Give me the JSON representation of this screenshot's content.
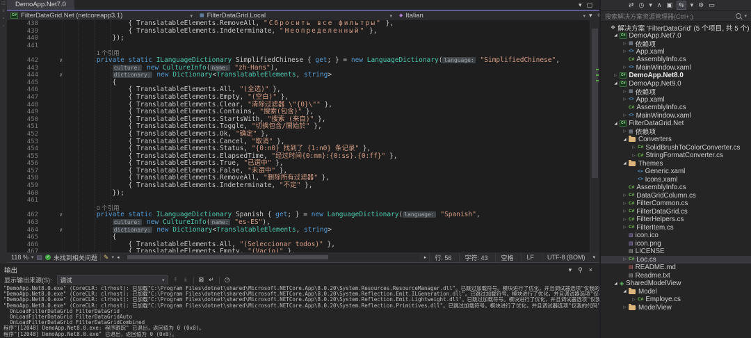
{
  "accents": {
    "active_window_line": "#615c97",
    "keyword_blue": "#569cd6",
    "type_teal": "#4ec9b0",
    "string_salmon": "#d69d85",
    "check_green": "#3fa33f",
    "folder_yellow": "#dcb67a",
    "selection_gray": "#37373d"
  },
  "left_strip_icons": [
    {
      "name": "side-toolbar-icon",
      "glyph": "◫"
    },
    {
      "name": "side-toolbar-icon",
      "glyph": "≡"
    },
    {
      "name": "side-toolbar-icon",
      "glyph": "▪"
    },
    {
      "name": "side-toolbar-icon",
      "glyph": "▫"
    }
  ],
  "editor": {
    "tab_label": "DemoApp.Net7.0",
    "tab_right_icons": [
      {
        "name": "active-files-dropdown-icon",
        "glyph": "▾"
      },
      {
        "name": "float-window-icon",
        "glyph": "▢"
      }
    ],
    "status": {
      "zoom": "118 %",
      "issues": "未找到相关问题",
      "line": "行: 56",
      "column": "字符: 43",
      "spaces": "空格",
      "line_ending": "LF",
      "encoding": "UTF-8 (BOM)"
    },
    "rows": [
      {
        "n": "438",
        "tk": [
          [
            "p",
            "                { TranslatableElements.RemoveAll, "
          ],
          [
            "sr",
            "\"Сбросить все фильтры\""
          ],
          [
            "p",
            " },"
          ]
        ]
      },
      {
        "n": "439",
        "tk": [
          [
            "p",
            "                { TranslatableElements.Indeterminate, "
          ],
          [
            "sr",
            "\"Неопределенный\""
          ],
          [
            "p",
            " },"
          ]
        ]
      },
      {
        "n": "440",
        "tk": [
          [
            "p",
            "            });"
          ]
        ]
      },
      {
        "n": "441",
        "tk": []
      },
      {
        "n": "",
        "lens": true,
        "tk": [
          [
            "l",
            "1 个引用"
          ]
        ]
      },
      {
        "n": "442",
        "c": 1,
        "tk": [
          [
            "p",
            "        "
          ],
          [
            "k",
            "private static "
          ],
          [
            "t",
            "ILanguageDictionary"
          ],
          [
            "p",
            " SimplifiedChinese { "
          ],
          [
            "k",
            "get"
          ],
          [
            "p",
            "; } = "
          ],
          [
            "k",
            "new"
          ],
          [
            "p",
            " "
          ],
          [
            "t",
            "LanguageDictionary"
          ],
          [
            "p",
            "("
          ],
          [
            "h",
            "language:"
          ],
          [
            "p",
            " "
          ],
          [
            "s",
            "\"SimplifiedChinese\""
          ],
          [
            "p",
            ","
          ]
        ]
      },
      {
        "n": "443",
        "tk": [
          [
            "p",
            "            "
          ],
          [
            "h",
            "culture:"
          ],
          [
            "p",
            " "
          ],
          [
            "k",
            "new"
          ],
          [
            "p",
            " "
          ],
          [
            "t",
            "CultureInfo"
          ],
          [
            "p",
            "("
          ],
          [
            "h",
            "name:"
          ],
          [
            "p",
            " "
          ],
          [
            "s",
            "\"zh-Hans\""
          ],
          [
            "p",
            "),"
          ]
        ]
      },
      {
        "n": "444",
        "c": 1,
        "tk": [
          [
            "p",
            "            "
          ],
          [
            "h",
            "dictionary:"
          ],
          [
            "p",
            " "
          ],
          [
            "k",
            "new"
          ],
          [
            "p",
            " "
          ],
          [
            "t",
            "Dictionary"
          ],
          [
            "p",
            "<"
          ],
          [
            "t",
            "TranslatableElements"
          ],
          [
            "p",
            ", "
          ],
          [
            "k",
            "string"
          ],
          [
            "p",
            ">"
          ]
        ]
      },
      {
        "n": "445",
        "tk": [
          [
            "p",
            "            {"
          ]
        ]
      },
      {
        "n": "446",
        "tk": [
          [
            "p",
            "                { TranslatableElements.All, "
          ],
          [
            "s",
            "\"(全选)\""
          ],
          [
            "p",
            " },"
          ]
        ]
      },
      {
        "n": "447",
        "tk": [
          [
            "p",
            "                { TranslatableElements.Empty, "
          ],
          [
            "s",
            "\"(空白)\""
          ],
          [
            "p",
            " },"
          ]
        ]
      },
      {
        "n": "448",
        "tk": [
          [
            "p",
            "                { TranslatableElements.Clear, "
          ],
          [
            "s",
            "\"清除过滤器 \\\"{0}\\\"\""
          ],
          [
            "p",
            " },"
          ]
        ]
      },
      {
        "n": "449",
        "tk": [
          [
            "p",
            "                { TranslatableElements.Contains, "
          ],
          [
            "s",
            "\"搜索(包含)\""
          ],
          [
            "p",
            " },"
          ]
        ]
      },
      {
        "n": "450",
        "tk": [
          [
            "p",
            "                { TranslatableElements.StartsWith, "
          ],
          [
            "s",
            "\"搜索 (来自)\""
          ],
          [
            "p",
            " },"
          ]
        ]
      },
      {
        "n": "451",
        "tk": [
          [
            "p",
            "                { TranslatableElements.Toggle, "
          ],
          [
            "s",
            "\"切换包含/開始於\""
          ],
          [
            "p",
            " },"
          ]
        ]
      },
      {
        "n": "452",
        "tk": [
          [
            "p",
            "                { TranslatableElements.Ok, "
          ],
          [
            "s",
            "\"确定\""
          ],
          [
            "p",
            " },"
          ]
        ]
      },
      {
        "n": "453",
        "tk": [
          [
            "p",
            "                { TranslatableElements.Cancel, "
          ],
          [
            "s",
            "\"取消\""
          ],
          [
            "p",
            " },"
          ]
        ]
      },
      {
        "n": "454",
        "tk": [
          [
            "p",
            "                { TranslatableElements.Status, "
          ],
          [
            "s",
            "\"{0:n0} 找到了 {1:n0} 条记录\""
          ],
          [
            "p",
            " },"
          ]
        ]
      },
      {
        "n": "455",
        "tk": [
          [
            "p",
            "                { TranslatableElements.ElapsedTime, "
          ],
          [
            "s",
            "\"经过时间{0:mm}:{0:ss}.{0:ff}\""
          ],
          [
            "p",
            " },"
          ]
        ]
      },
      {
        "n": "456",
        "tk": [
          [
            "p",
            "                { TranslatableElements.True, "
          ],
          [
            "s",
            "\"已選中\""
          ],
          [
            "p",
            " },"
          ]
        ]
      },
      {
        "n": "457",
        "tk": [
          [
            "p",
            "                { TranslatableElements.False, "
          ],
          [
            "s",
            "\"未選中\""
          ],
          [
            "p",
            " },"
          ]
        ]
      },
      {
        "n": "458",
        "tk": [
          [
            "p",
            "                { TranslatableElements.RemoveAll, "
          ],
          [
            "s",
            "\"删除所有过滤器\""
          ],
          [
            "p",
            " },"
          ]
        ]
      },
      {
        "n": "459",
        "tk": [
          [
            "p",
            "                { TranslatableElements.Indeterminate, "
          ],
          [
            "s",
            "\"不定\""
          ],
          [
            "p",
            " },"
          ]
        ]
      },
      {
        "n": "460",
        "tk": [
          [
            "p",
            "            });"
          ]
        ]
      },
      {
        "n": "461",
        "tk": []
      },
      {
        "n": "",
        "lens": true,
        "tk": [
          [
            "l",
            "0 个引用"
          ]
        ]
      },
      {
        "n": "462",
        "c": 1,
        "tk": [
          [
            "p",
            "        "
          ],
          [
            "k",
            "private static "
          ],
          [
            "t",
            "ILanguageDictionary"
          ],
          [
            "p",
            " Spanish { "
          ],
          [
            "k",
            "get"
          ],
          [
            "p",
            "; } = "
          ],
          [
            "k",
            "new"
          ],
          [
            "p",
            " "
          ],
          [
            "t",
            "LanguageDictionary"
          ],
          [
            "p",
            "("
          ],
          [
            "h",
            "language:"
          ],
          [
            "p",
            " "
          ],
          [
            "s",
            "\"Spanish\""
          ],
          [
            "p",
            ","
          ]
        ]
      },
      {
        "n": "463",
        "tk": [
          [
            "p",
            "            "
          ],
          [
            "h",
            "culture:"
          ],
          [
            "p",
            " "
          ],
          [
            "k",
            "new"
          ],
          [
            "p",
            " "
          ],
          [
            "t",
            "CultureInfo"
          ],
          [
            "p",
            "("
          ],
          [
            "h",
            "name:"
          ],
          [
            "p",
            " "
          ],
          [
            "s",
            "\"es-ES\""
          ],
          [
            "p",
            "),"
          ]
        ]
      },
      {
        "n": "464",
        "c": 1,
        "tk": [
          [
            "p",
            "            "
          ],
          [
            "h",
            "dictionary:"
          ],
          [
            "p",
            " "
          ],
          [
            "k",
            "new"
          ],
          [
            "p",
            " "
          ],
          [
            "t",
            "Dictionary"
          ],
          [
            "p",
            "<"
          ],
          [
            "t",
            "TranslatableElements"
          ],
          [
            "p",
            ", "
          ],
          [
            "k",
            "string"
          ],
          [
            "p",
            ">"
          ]
        ]
      },
      {
        "n": "465",
        "tk": [
          [
            "p",
            "            {"
          ]
        ]
      },
      {
        "n": "466",
        "tk": [
          [
            "p",
            "                { TranslatableElements.All, "
          ],
          [
            "s",
            "\"(Seleccionar todos)\""
          ],
          [
            "p",
            " },"
          ]
        ]
      },
      {
        "n": "467",
        "tk": [
          [
            "p",
            "                { TranslatableElements.Empty, "
          ],
          [
            "s",
            "\"(Vacío)\""
          ],
          [
            "p",
            " },"
          ]
        ]
      }
    ]
  },
  "navbar": {
    "project": "FilterDataGrid.Net (netcoreapp3.1)",
    "class_name": "FilterDataGrid.Local",
    "member": "Italian",
    "right_icons": [
      {
        "name": "navbar-dropdown-icon",
        "glyph": "▾"
      },
      {
        "name": "split-window-icon",
        "glyph": "+"
      }
    ]
  },
  "output": {
    "title": "输出",
    "source_label": "显示输出来源(S):",
    "source_value": "调试",
    "toolbar_icons": [
      {
        "name": "previous-message-icon",
        "glyph": "↟",
        "disabled": true
      },
      {
        "name": "next-message-icon",
        "glyph": "↡",
        "disabled": true
      },
      {
        "sep": true
      },
      {
        "name": "clear-all-icon",
        "glyph": "⊠"
      },
      {
        "name": "toggle-word-wrap-icon",
        "glyph": "↵"
      },
      {
        "sep": true
      },
      {
        "name": "time-icon",
        "glyph": "◷"
      }
    ],
    "panel_buttons": [
      {
        "name": "window-position-icon",
        "glyph": "▾"
      },
      {
        "name": "pin-icon",
        "glyph": "⚲"
      },
      {
        "name": "close-icon",
        "glyph": "×"
      }
    ],
    "lines": [
      "\"DemoApp.Net8.0.exe\" (CoreCLR: clrhost): 已加载\"C:\\Program Files\\dotnet\\shared\\Microsoft.NETCore.App\\8.0.20\\System.Resources.ResourceManager.dll\"。已跳过加载符号。模块进行了优化，并且调试器选项\"仅我的代码\"已启用。",
      "\"DemoApp.Net8.0.exe\" (CoreCLR: clrhost): 已加载\"C:\\Program Files\\dotnet\\shared\\Microsoft.NETCore.App\\8.0.20\\System.Reflection.Emit.ILGeneration.dll\"。已跳过加载符号。模块进行了优化，并且调试器选项\"仅我的代码\"已启用。",
      "\"DemoApp.Net8.0.exe\" (CoreCLR: clrhost): 已加载\"C:\\Program Files\\dotnet\\shared\\Microsoft.NETCore.App\\8.0.20\\System.Reflection.Emit.Lightweight.dll\"。已跳过加载符号。模块进行了优化，并且调试器选项\"仅我的代码\"已启用。",
      "\"DemoApp.Net8.0.exe\" (CoreCLR: clrhost): 已加载\"C:\\Program Files\\dotnet\\shared\\Microsoft.NETCore.App\\8.0.20\\System.Reflection.Primitives.dll\"。已跳过加载符号。模块进行了优化，并且调试器选项\"仅我的代码\"已启用。",
      "  OnLoadFilterDataGrid FilterDataGrid",
      "  OnLoadFilterDataGrid FilterDataGridAuto",
      "  OnLoadFilterDataGrid FilterDataGridCombined",
      "程序\"[12048] DemoApp.Net8.0.exe: 程序跟踪\" 已退出，返回值为 0 (0x0)。",
      "程序\"[12048] DemoApp.Net8.0.exe\" 已退出，返回值为 0 (0x0)。"
    ]
  },
  "explorer": {
    "search_placeholder": "搜索解决方案资源管理器(Ctrl+;)",
    "toolbar_icons": [
      {
        "name": "switch-views-icon",
        "glyph": "⇄"
      },
      {
        "name": "pending-changes-filter-icon",
        "glyph": "◷"
      },
      {
        "name": "filter-dropdown-icon",
        "glyph": "▾"
      },
      {
        "name": "collapse-all-icon",
        "glyph": "∧"
      },
      {
        "name": "show-all-files-icon",
        "glyph": "▣"
      },
      {
        "name": "sync-with-active-document-icon",
        "glyph": "⇆",
        "active": true
      },
      {
        "name": "sync-dropdown-icon",
        "glyph": "▾"
      },
      {
        "name": "properties-icon",
        "glyph": "⚙"
      },
      {
        "name": "preview-selected-items-icon",
        "glyph": "▭"
      }
    ],
    "icon_glyphs": {
      "solution": "❖",
      "csproj": "C#",
      "cs": "C#",
      "xaml": "<>",
      "deps": "▦",
      "img": "▧",
      "doc": "▤",
      "md": "▤",
      "shared": "◈",
      "folder": ""
    },
    "tree": [
      [
        0,
        0,
        "solution",
        "解决方案 'FilterDataGrid' (5 个项目, 共 5 个)",
        ""
      ],
      [
        1,
        2,
        "csproj",
        "DemoApp.Net7.0",
        ""
      ],
      [
        2,
        1,
        "deps",
        "依赖项",
        ""
      ],
      [
        2,
        1,
        "xaml",
        "App.xaml",
        ""
      ],
      [
        2,
        0,
        "cs",
        "AssemblyInfo.cs",
        ""
      ],
      [
        2,
        1,
        "xaml",
        "MainWindow.xaml",
        ""
      ],
      [
        1,
        1,
        "csproj",
        "DemoApp.Net8.0",
        "b"
      ],
      [
        1,
        2,
        "csproj",
        "DemoApp.Net9.0",
        ""
      ],
      [
        2,
        1,
        "deps",
        "依赖项",
        ""
      ],
      [
        2,
        1,
        "xaml",
        "App.xaml",
        ""
      ],
      [
        2,
        0,
        "cs",
        "AssemblyInfo.cs",
        ""
      ],
      [
        2,
        1,
        "xaml",
        "MainWindow.xaml",
        ""
      ],
      [
        1,
        2,
        "csproj",
        "FilterDataGrid.Net",
        ""
      ],
      [
        2,
        1,
        "deps",
        "依赖项",
        ""
      ],
      [
        2,
        2,
        "folder",
        "Converters",
        ""
      ],
      [
        3,
        1,
        "cs",
        "SolidBrushToColorConverter.cs",
        ""
      ],
      [
        3,
        1,
        "cs",
        "StringFormatConverter.cs",
        ""
      ],
      [
        2,
        2,
        "folder",
        "Themes",
        ""
      ],
      [
        3,
        0,
        "xaml",
        "Generic.xaml",
        ""
      ],
      [
        3,
        0,
        "xaml",
        "Icons.xaml",
        ""
      ],
      [
        2,
        0,
        "cs",
        "AssemblyInfo.cs",
        ""
      ],
      [
        2,
        1,
        "cs",
        "DataGridColumn.cs",
        ""
      ],
      [
        2,
        1,
        "cs",
        "FilterCommon.cs",
        ""
      ],
      [
        2,
        1,
        "cs",
        "FilterDataGrid.cs",
        ""
      ],
      [
        2,
        1,
        "cs",
        "FilterHelpers.cs",
        ""
      ],
      [
        2,
        1,
        "cs",
        "FilterItem.cs",
        ""
      ],
      [
        2,
        0,
        "img",
        "icon.ico",
        ""
      ],
      [
        2,
        0,
        "img",
        "icon.png",
        ""
      ],
      [
        2,
        0,
        "doc",
        "LICENSE",
        ""
      ],
      [
        2,
        1,
        "cs",
        "Loc.cs",
        "s"
      ],
      [
        2,
        0,
        "md",
        "README.md",
        ""
      ],
      [
        2,
        0,
        "doc",
        "Readme.txt",
        ""
      ],
      [
        1,
        2,
        "shared",
        "SharedModelView",
        ""
      ],
      [
        2,
        2,
        "folder",
        "Model",
        ""
      ],
      [
        3,
        1,
        "cs",
        "Employe.cs",
        ""
      ],
      [
        2,
        1,
        "folder",
        "ModelView",
        ""
      ]
    ]
  }
}
